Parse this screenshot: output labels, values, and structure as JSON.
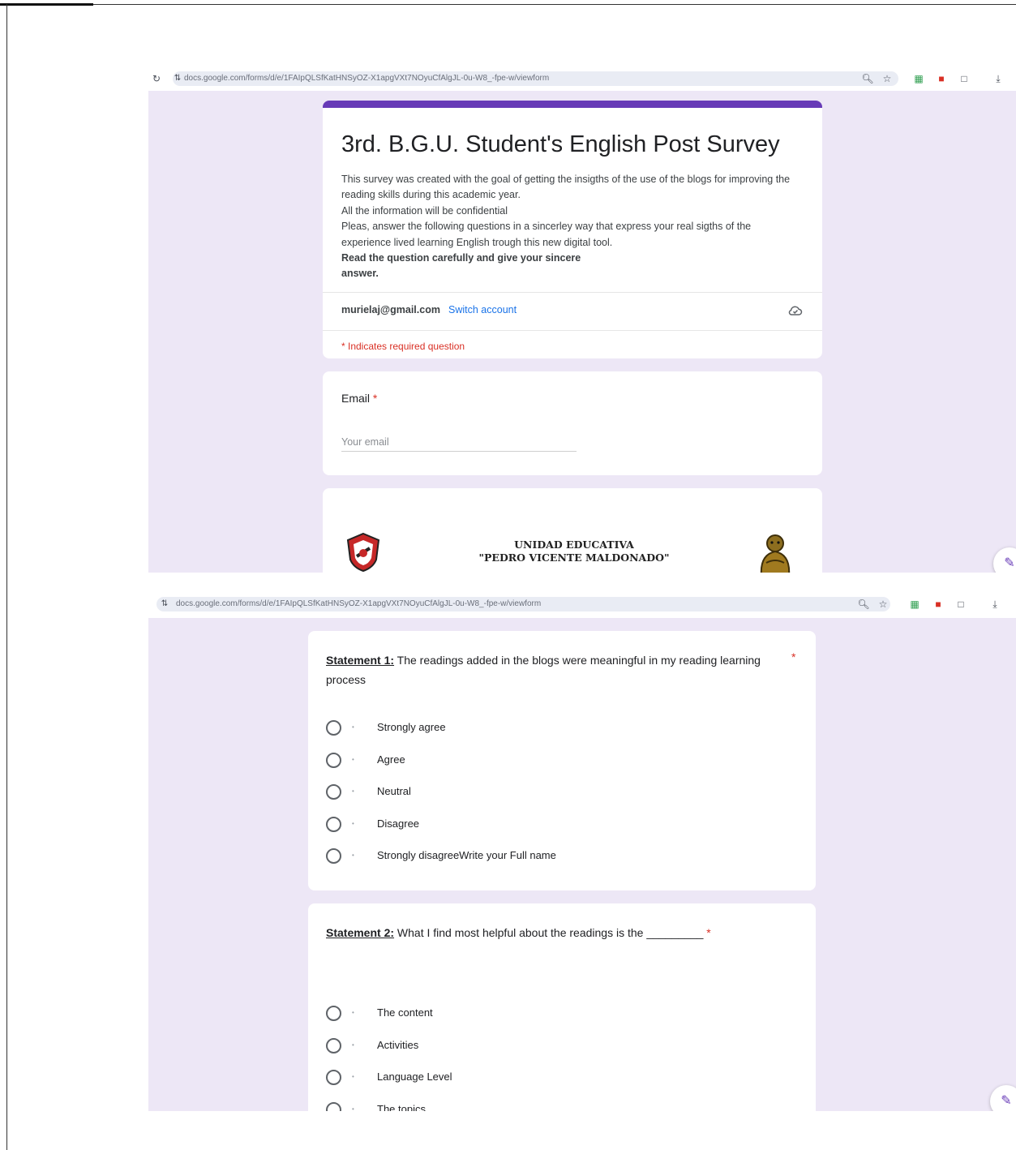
{
  "browser": {
    "url": "docs.google.com/forms/d/e/1FAIpQLSfKatHNSyOZ-X1apgVXt7NOyuCfAlgJL-0u-W8_-fpe-w/viewform"
  },
  "form": {
    "title": "3rd. B.G.U. Student's English Post Survey",
    "description": [
      "This survey was created with the goal of getting the insigths of the use of the blogs for improving the reading skills during this academic year.",
      "All the information will be confidential",
      "Pleas, answer the following questions in a sincerley way that express your real sigths of the experience lived learning  English trough this new digital tool."
    ],
    "description_bold": "Read the question carefully and give your sincere answer.",
    "account_email": "murielaj@gmail.com",
    "switch_account": "Switch account",
    "required_note": "* Indicates required question"
  },
  "email_question": {
    "label": "Email",
    "required_mark": "*",
    "placeholder": "Your email"
  },
  "header_image": {
    "school_line1": "UNIDAD EDUCATIVA",
    "school_line2": "\"PEDRO VICENTE MALDONADO\""
  },
  "statement1": {
    "prefix": "Statement 1:",
    "text": " The readings added in the blogs were meaningful in my reading learning process",
    "required_mark": "*",
    "options": [
      "Strongly agree",
      "Agree",
      "Neutral",
      "Disagree",
      "Strongly disagreeWrite your Full name"
    ]
  },
  "statement2": {
    "prefix": "Statement 2:",
    "text": " What I find most helpful about the readings is the _________",
    "required_mark": "*",
    "options": [
      "The content",
      "Activities",
      "Language Level",
      "The topics"
    ]
  },
  "colors": {
    "accent": "#673ab7",
    "background": "#ede7f6",
    "required": "#d93025",
    "link": "#1a73e8"
  }
}
